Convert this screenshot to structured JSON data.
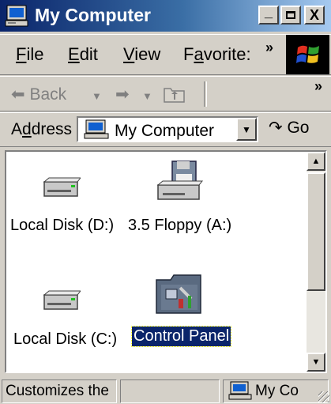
{
  "window": {
    "title": "My Computer",
    "controls": {
      "minimize": "_",
      "maximize": "□",
      "close": "X"
    }
  },
  "menu": {
    "items": [
      {
        "label": "File",
        "accel": "F",
        "rest": "ile"
      },
      {
        "label": "Edit",
        "accel": "E",
        "rest": "dit"
      },
      {
        "label": "View",
        "accel": "V",
        "rest": "iew"
      },
      {
        "label": "Favorite:",
        "accel": "a",
        "pre": "F",
        "rest": "vorite:"
      }
    ],
    "overflow": "»"
  },
  "toolbar": {
    "back_label": "Back",
    "overflow": "»"
  },
  "address": {
    "label_pre": "A",
    "label_accel": "d",
    "label_rest": "dress",
    "value": "My Computer",
    "go_label": "Go"
  },
  "content": {
    "items": [
      {
        "label": "Local Disk (D:)",
        "icon": "hard-drive-icon",
        "selected": false
      },
      {
        "label": "3.5 Floppy (A:)",
        "icon": "floppy-drive-icon",
        "selected": false
      },
      {
        "label": "Local Disk (C:)",
        "icon": "hard-drive-icon",
        "selected": false
      },
      {
        "label": "Control Panel",
        "icon": "control-panel-icon",
        "selected": true
      }
    ]
  },
  "status": {
    "description": "Customizes the",
    "zone": "My Co"
  },
  "colors": {
    "titlebar_start": "#0a246a",
    "titlebar_end": "#a6caf0",
    "selection": "#0a246a",
    "face": "#d4d0c8"
  }
}
